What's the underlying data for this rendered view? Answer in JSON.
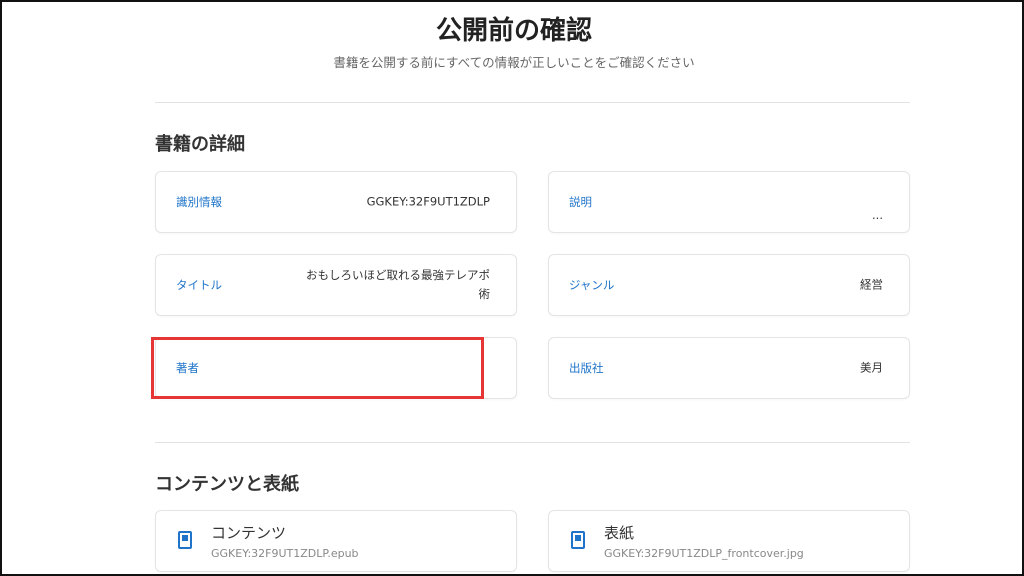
{
  "header": {
    "title": "公開前の確認",
    "subtitle": "書籍を公開する前にすべての情報が正しいことをご確認ください"
  },
  "details": {
    "section_title": "書籍の詳細",
    "fields": {
      "identifier": {
        "label": "識別情報",
        "value": "GGKEY:32F9UT1ZDLP"
      },
      "description": {
        "label": "説明",
        "value": "..."
      },
      "title": {
        "label": "タイトル",
        "value": "おもしろいほど取れる最強テレアポ術"
      },
      "genre": {
        "label": "ジャンル",
        "value": "経営"
      },
      "author": {
        "label": "著者",
        "value": ""
      },
      "publisher": {
        "label": "出版社",
        "value": "美月"
      }
    }
  },
  "contents": {
    "section_title": "コンテンツと表紙",
    "files": [
      {
        "name": "コンテンツ",
        "filename": "GGKEY:32F9UT1ZDLP.epub",
        "icon": "file-icon"
      },
      {
        "name": "表紙",
        "filename": "GGKEY:32F9UT1ZDLP_frontcover.jpg",
        "icon": "file-icon"
      }
    ]
  },
  "colors": {
    "label_blue": "#1f74c9",
    "highlight_red": "#e53535"
  }
}
